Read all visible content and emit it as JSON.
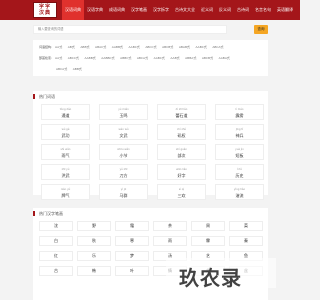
{
  "logo": {
    "line1": "字字",
    "line2": "汉典"
  },
  "nav": [
    "汉语词典",
    "汉语字典",
    "成语词典",
    "汉字笔画",
    "汉字拆字",
    "古诗文大全",
    "近义词",
    "反义词",
    "古诗词",
    "名言名句",
    "英语翻译"
  ],
  "search": {
    "placeholder": "输入要查询的词语",
    "button": "查询"
  },
  "filters": {
    "row1_label": "词语结构:",
    "row1": [
      "AA式",
      "AB式",
      "ABB式",
      "ABAC式",
      "AABB式",
      "AABC式",
      "ABCC式",
      "ABCB式",
      "ABAB式",
      "AABC式",
      "ABCA式"
    ],
    "row2_label": "部首检索:",
    "row2": [
      "AA式",
      "ABCC式",
      "AABB式",
      "AABBC式",
      "ABBC式",
      "ABCA式",
      "AABC式",
      "AAB式",
      "ABBA式",
      "ABCB式",
      "AABA式"
    ],
    "row3": [
      "ABCA式",
      "ABB式"
    ]
  },
  "hot_words": {
    "title": "热门词语",
    "items": [
      {
        "py": "tòng dǎo",
        "w": "通道"
      },
      {
        "py": "yù miǎn",
        "w": "玉鸣"
      },
      {
        "py": "dì zhī lǎo",
        "w": "蕾石道"
      },
      {
        "py": "lì máo",
        "w": "霹雳"
      },
      {
        "py": "wǔ gè",
        "w": "武功"
      },
      {
        "py": "wén wǔ",
        "w": "文武"
      },
      {
        "py": "chí zhǔ",
        "w": "矶权"
      },
      {
        "py": "jīng tǐ",
        "w": "神兵"
      },
      {
        "py": "shì wǎn",
        "w": "雨气"
      },
      {
        "py": "shōu wǎn",
        "w": "小节"
      },
      {
        "py": "shì guǎn",
        "w": "部次"
      },
      {
        "py": "yuè jìn",
        "w": "短板"
      },
      {
        "py": "zhī yú",
        "w": "洪武"
      },
      {
        "py": "yǔ zhī",
        "w": "刀方"
      },
      {
        "py": "wān liǎo",
        "w": "好字"
      },
      {
        "py": "lì tǔ",
        "w": "历史"
      },
      {
        "py": "nián yǔ",
        "w": "牌气"
      },
      {
        "py": "yì jū",
        "w": "马群"
      },
      {
        "py": "sì qí",
        "w": "三欢"
      },
      {
        "py": "yǐng hǎo",
        "w": "溶流"
      }
    ]
  },
  "hot_chars": {
    "title": "热门汉字笔画",
    "items": [
      "沈",
      "野",
      "霜",
      "茶",
      "周",
      "菜",
      "白",
      "秋",
      "寒",
      "雨",
      "霖",
      "秦",
      "红",
      "乐",
      "梦",
      "汤",
      "艺",
      "鱼",
      "古",
      "韩",
      "叶",
      "情",
      "花",
      "丝"
    ]
  },
  "watermark": "玖农录"
}
